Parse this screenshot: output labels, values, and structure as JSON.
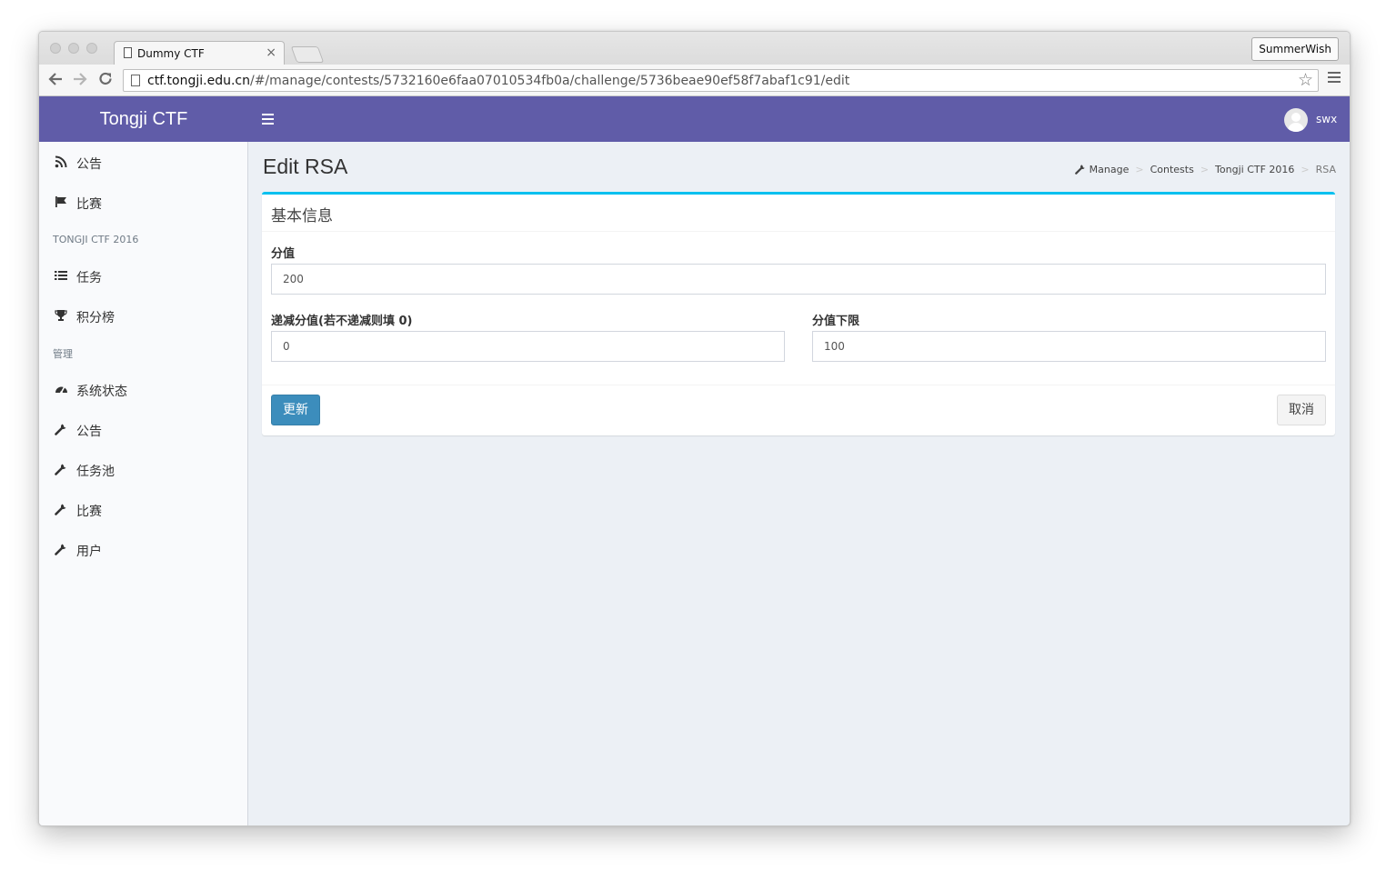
{
  "browser": {
    "tab_title": "Dummy CTF",
    "tab_close": "×",
    "profile_name": "SummerWish",
    "url_host": "ctf.tongji.edu.cn",
    "url_path": "/#/manage/contests/5732160e6faa07010534fb0a/challenge/5736beae90ef58f7abaf1c91/edit"
  },
  "header": {
    "brand": "Tongji CTF",
    "username": "swx",
    "brand_color": "#605ca8"
  },
  "sidebar": {
    "items_top": [
      {
        "label": "公告",
        "icon": "rss-icon"
      },
      {
        "label": "比赛",
        "icon": "flag-icon"
      }
    ],
    "section_contest": "TONGJI CTF 2016",
    "items_contest": [
      {
        "label": "任务",
        "icon": "list-icon"
      },
      {
        "label": "积分榜",
        "icon": "trophy-icon"
      }
    ],
    "section_manage": "管理",
    "items_manage": [
      {
        "label": "系统状态",
        "icon": "dashboard-icon"
      },
      {
        "label": "公告",
        "icon": "wrench-icon"
      },
      {
        "label": "任务池",
        "icon": "wrench-icon"
      },
      {
        "label": "比赛",
        "icon": "wrench-icon"
      },
      {
        "label": "用户",
        "icon": "wrench-icon"
      }
    ]
  },
  "page": {
    "title": "Edit RSA",
    "breadcrumb": [
      "Manage",
      "Contests",
      "Tongji CTF 2016",
      "RSA"
    ]
  },
  "form": {
    "box_title": "基本信息",
    "score_label": "分值",
    "score_value": "200",
    "decrease_label": "递减分值(若不递减则填 0)",
    "decrease_value": "0",
    "min_label": "分值下限",
    "min_value": "100",
    "update_button": "更新",
    "cancel_button": "取消",
    "accent_color": "#00c0ef",
    "primary_color": "#3c8dbc"
  }
}
